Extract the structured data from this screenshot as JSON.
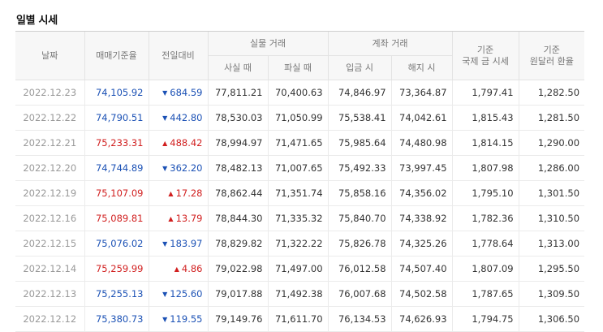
{
  "page": {
    "title": "일별 시세"
  },
  "table": {
    "headers": {
      "date": "날짜",
      "base_rate": "매매기준율",
      "change": "전일대비",
      "cash_group": "실물 거래",
      "cash_buy": "사실 때",
      "cash_sell": "파실 때",
      "account_group": "계좌 거래",
      "deposit": "입금 시",
      "withdraw": "해지 시",
      "intl_price": "기준\n국제 금 시세",
      "usd_rate": "기준\n원달러 환율"
    },
    "colors": {
      "up": "#d11f1f",
      "down": "#1b51b5"
    },
    "rows": [
      {
        "date": "2022.12.23",
        "base_rate": "74,105.92",
        "direction": "down",
        "arrow": "▼",
        "change": "684.59",
        "cash_buy": "77,811.21",
        "cash_sell": "70,400.63",
        "deposit": "74,846.97",
        "withdraw": "73,364.87",
        "intl_price": "1,797.41",
        "usd_rate": "1,282.50"
      },
      {
        "date": "2022.12.22",
        "base_rate": "74,790.51",
        "direction": "down",
        "arrow": "▼",
        "change": "442.80",
        "cash_buy": "78,530.03",
        "cash_sell": "71,050.99",
        "deposit": "75,538.41",
        "withdraw": "74,042.61",
        "intl_price": "1,815.43",
        "usd_rate": "1,281.50"
      },
      {
        "date": "2022.12.21",
        "base_rate": "75,233.31",
        "direction": "up",
        "arrow": "▲",
        "change": "488.42",
        "cash_buy": "78,994.97",
        "cash_sell": "71,471.65",
        "deposit": "75,985.64",
        "withdraw": "74,480.98",
        "intl_price": "1,814.15",
        "usd_rate": "1,290.00"
      },
      {
        "date": "2022.12.20",
        "base_rate": "74,744.89",
        "direction": "down",
        "arrow": "▼",
        "change": "362.20",
        "cash_buy": "78,482.13",
        "cash_sell": "71,007.65",
        "deposit": "75,492.33",
        "withdraw": "73,997.45",
        "intl_price": "1,807.98",
        "usd_rate": "1,286.00"
      },
      {
        "date": "2022.12.19",
        "base_rate": "75,107.09",
        "direction": "up",
        "arrow": "▲",
        "change": "17.28",
        "cash_buy": "78,862.44",
        "cash_sell": "71,351.74",
        "deposit": "75,858.16",
        "withdraw": "74,356.02",
        "intl_price": "1,795.10",
        "usd_rate": "1,301.50"
      },
      {
        "date": "2022.12.16",
        "base_rate": "75,089.81",
        "direction": "up",
        "arrow": "▲",
        "change": "13.79",
        "cash_buy": "78,844.30",
        "cash_sell": "71,335.32",
        "deposit": "75,840.70",
        "withdraw": "74,338.92",
        "intl_price": "1,782.36",
        "usd_rate": "1,310.50"
      },
      {
        "date": "2022.12.15",
        "base_rate": "75,076.02",
        "direction": "down",
        "arrow": "▼",
        "change": "183.97",
        "cash_buy": "78,829.82",
        "cash_sell": "71,322.22",
        "deposit": "75,826.78",
        "withdraw": "74,325.26",
        "intl_price": "1,778.64",
        "usd_rate": "1,313.00"
      },
      {
        "date": "2022.12.14",
        "base_rate": "75,259.99",
        "direction": "up",
        "arrow": "▲",
        "change": "4.86",
        "cash_buy": "79,022.98",
        "cash_sell": "71,497.00",
        "deposit": "76,012.58",
        "withdraw": "74,507.40",
        "intl_price": "1,807.09",
        "usd_rate": "1,295.50"
      },
      {
        "date": "2022.12.13",
        "base_rate": "75,255.13",
        "direction": "down",
        "arrow": "▼",
        "change": "125.60",
        "cash_buy": "79,017.88",
        "cash_sell": "71,492.38",
        "deposit": "76,007.68",
        "withdraw": "74,502.58",
        "intl_price": "1,787.65",
        "usd_rate": "1,309.50"
      },
      {
        "date": "2022.12.12",
        "base_rate": "75,380.73",
        "direction": "down",
        "arrow": "▼",
        "change": "119.55",
        "cash_buy": "79,149.76",
        "cash_sell": "71,611.70",
        "deposit": "76,134.53",
        "withdraw": "74,626.93",
        "intl_price": "1,794.75",
        "usd_rate": "1,306.50"
      }
    ]
  }
}
